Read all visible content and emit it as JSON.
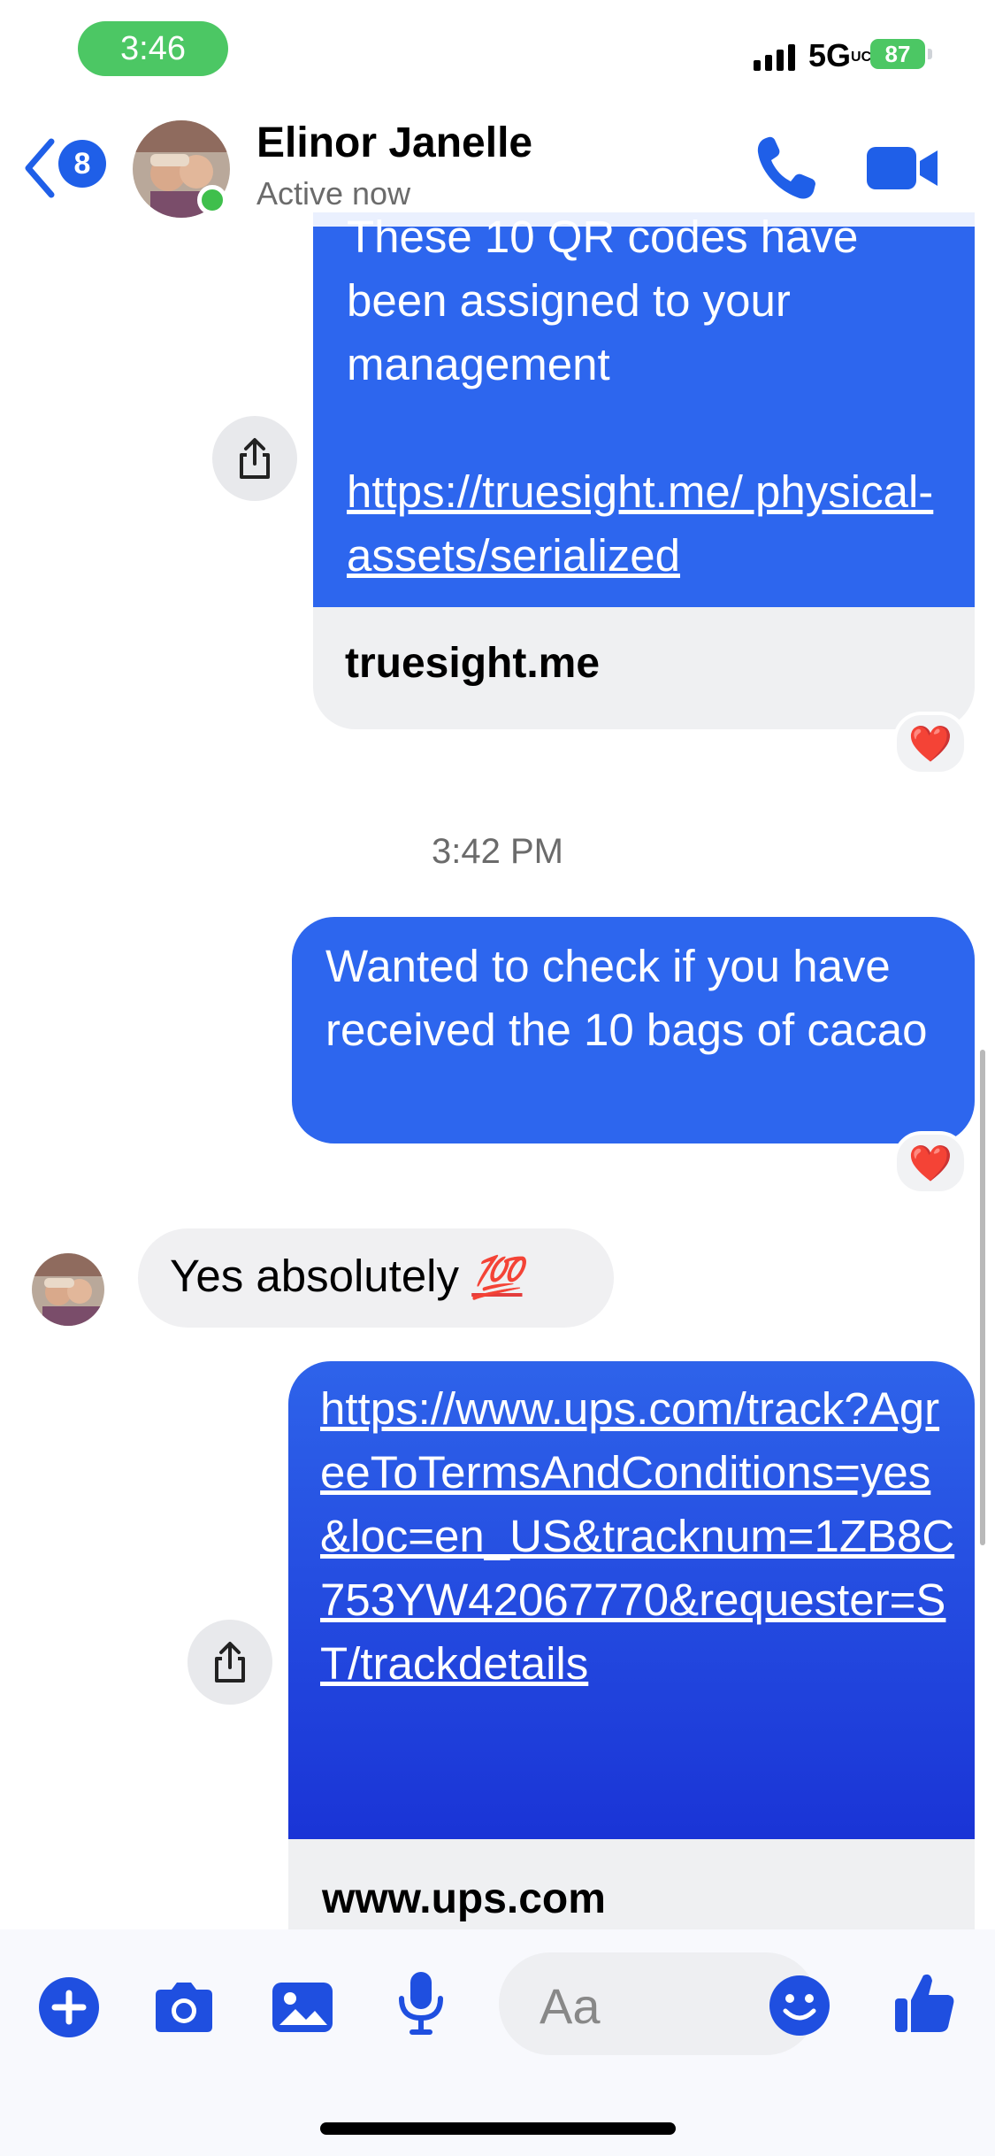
{
  "status_bar": {
    "time": "3:46",
    "network": "5G",
    "network_suffix": "UC",
    "battery": "87"
  },
  "header": {
    "unread_count": "8",
    "contact_name": "Elinor Janelle",
    "contact_status": "Active now"
  },
  "messages": {
    "m1_text": "These 10 QR codes have been assigned to your management",
    "m1_link": "https://truesight.me/ physical-assets/serialized",
    "m1_domain": "truesight.me",
    "m1_reaction": "❤️",
    "timestamp": "3:42 PM",
    "m2_text": "Wanted to check if you have received the 10 bags of cacao",
    "m2_reaction": "❤️",
    "m3_text": "Yes absolutely",
    "m3_emoji": "💯",
    "m4_link": "https://www.ups.com/track?AgreeToTermsAndConditions=yes&loc=en_US&tracknum=1ZB8C753YW42067770&requester=ST/trackdetails",
    "m4_domain": "www.ups.com"
  },
  "composer": {
    "placeholder": "Aa"
  },
  "colors": {
    "accent": "#2d66ee",
    "online": "#4cc764",
    "link_gradient_end": "#1a34d6"
  }
}
